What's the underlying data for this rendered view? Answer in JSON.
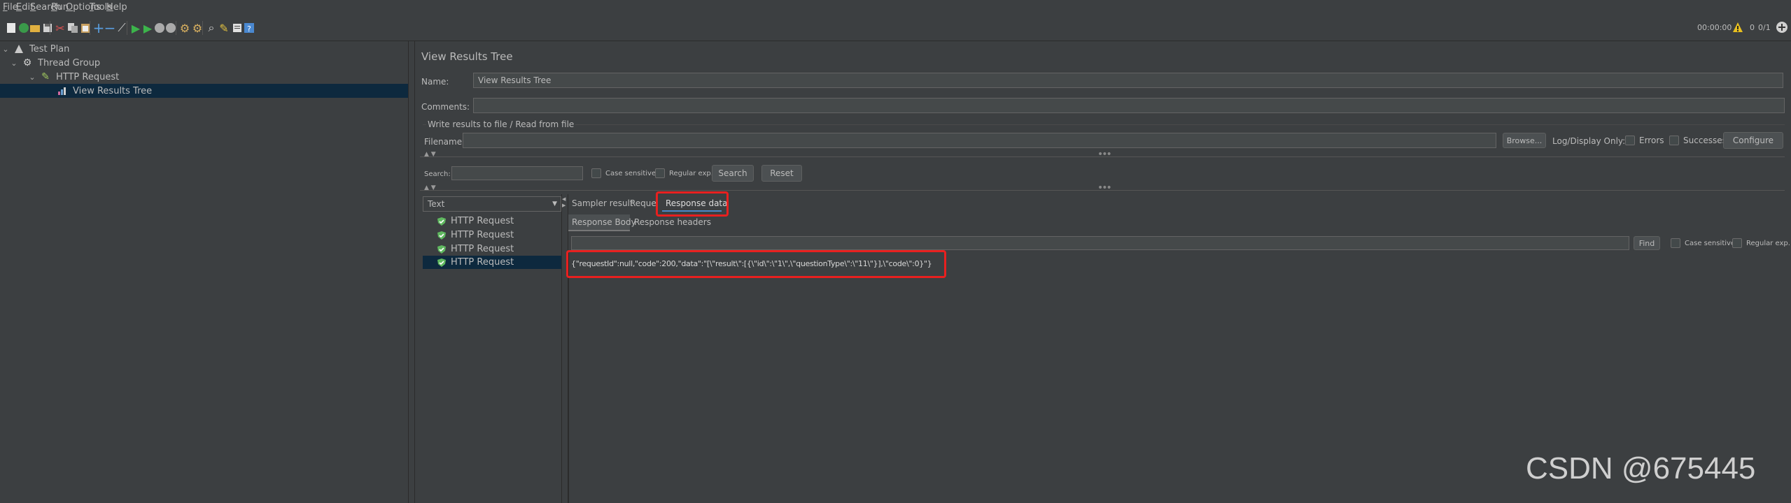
{
  "menu": [
    "File",
    "Edit",
    "Search",
    "Run",
    "Options",
    "Tools",
    "Help"
  ],
  "status": {
    "timer": "00:00:00",
    "warnings": "0",
    "threads": "0/1"
  },
  "tree": {
    "items": [
      {
        "label": "Test Plan"
      },
      {
        "label": "Thread Group"
      },
      {
        "label": "HTTP Request"
      },
      {
        "label": "View Results Tree"
      }
    ]
  },
  "panel": {
    "title": "View Results Tree",
    "name_label": "Name:",
    "name_value": "View Results Tree",
    "comments_label": "Comments:",
    "comments_value": "",
    "file_section": "Write results to file / Read from file",
    "filename_label": "Filename",
    "browse": "Browse...",
    "log_only": "Log/Display Only:",
    "errors": "Errors",
    "successes": "Successes",
    "configure": "Configure"
  },
  "search": {
    "label": "Search:",
    "case_sensitive": "Case sensitive",
    "regular_exp": "Regular exp.",
    "search_button": "Search",
    "reset_button": "Reset"
  },
  "renderer": {
    "selected": "Text"
  },
  "results": [
    "HTTP Request",
    "HTTP Request",
    "HTTP Request",
    "HTTP Request"
  ],
  "tabs": {
    "sampler_result": "Sampler result",
    "request": "Request",
    "response_data": "Response data"
  },
  "subtabs": {
    "body": "Response Body",
    "headers": "Response headers"
  },
  "find": {
    "button": "Find",
    "case_sensitive": "Case sensitive",
    "regular_exp": "Regular exp."
  },
  "response_body": "{\"requestId\":null,\"code\":200,\"data\":\"[\\\"result\\\":[{\\\"id\\\":\\\"1\\\",\\\"questionType\\\":\\\"11\\\"}],\\\"code\\\":0}\"}",
  "watermark": "CSDN @675445",
  "colors": {
    "accent_red": "#e8201f",
    "selection": "#0d293e",
    "background": "#3c3f41",
    "shield_green": "#5fb85f"
  }
}
